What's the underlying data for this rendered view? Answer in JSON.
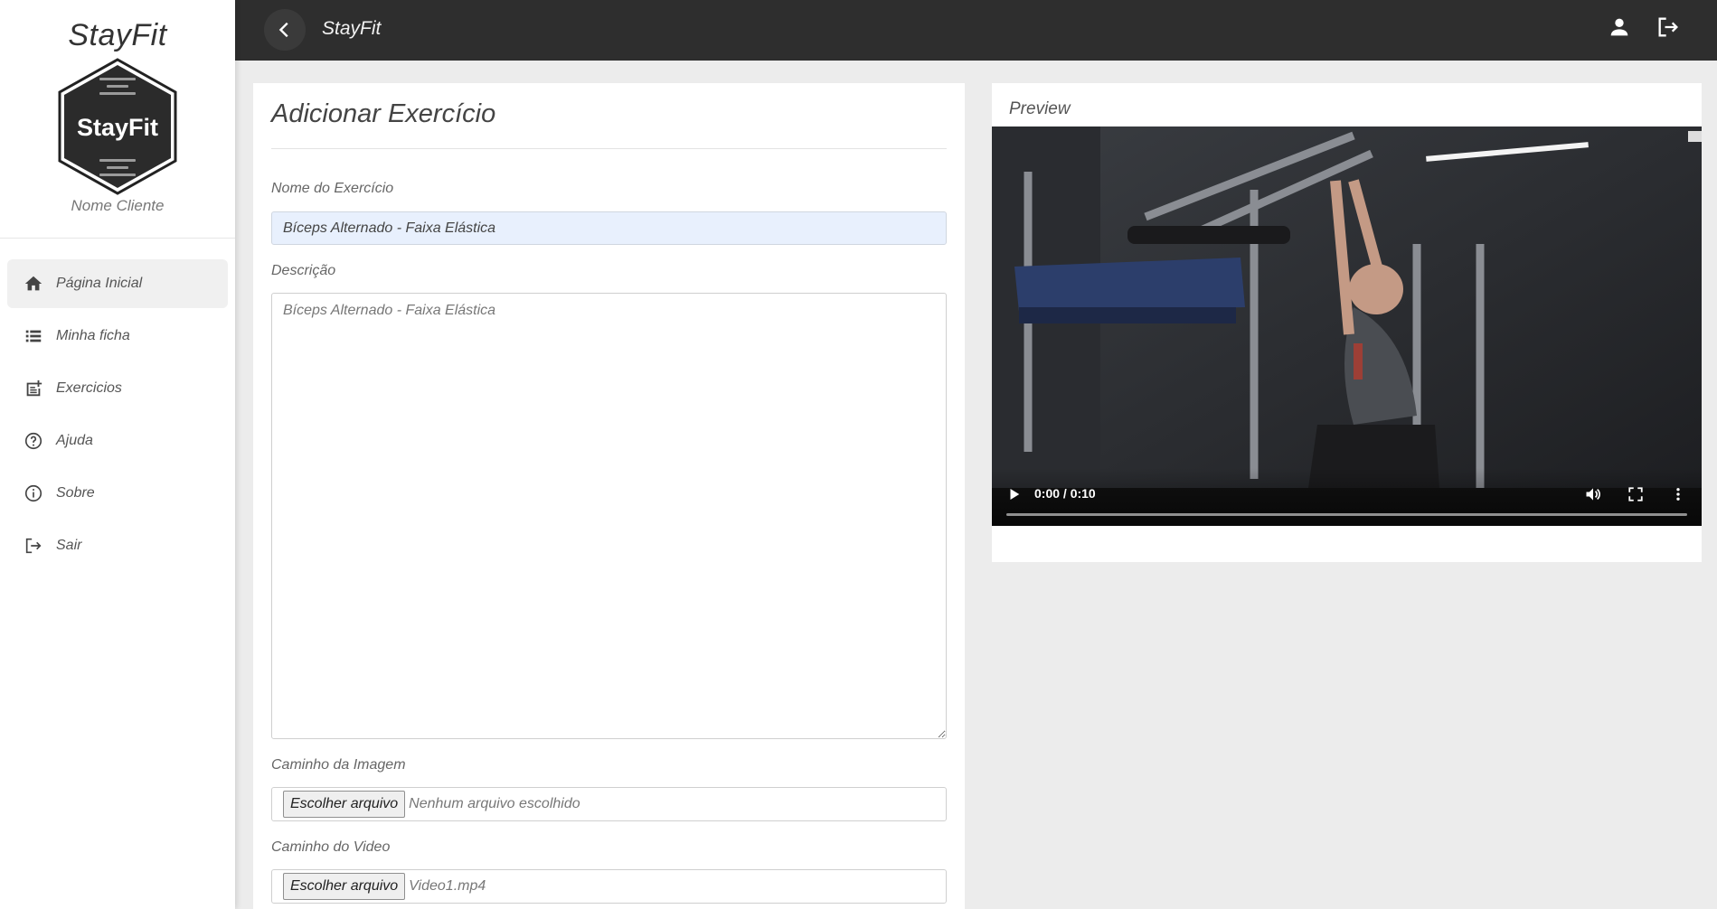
{
  "sidebar": {
    "brand": "StayFit",
    "logo_text": "StayFit",
    "client_name": "Nome Cliente",
    "items": [
      {
        "label": "Página Inicial",
        "icon": "home-icon",
        "active": true
      },
      {
        "label": "Minha ficha",
        "icon": "list-icon",
        "active": false
      },
      {
        "label": "Exercicios",
        "icon": "note-add-icon",
        "active": false
      },
      {
        "label": "Ajuda",
        "icon": "help-circle-icon",
        "active": false
      },
      {
        "label": "Sobre",
        "icon": "info-circle-icon",
        "active": false
      },
      {
        "label": "Sair",
        "icon": "logout-icon",
        "active": false
      }
    ]
  },
  "topbar": {
    "title": "StayFit",
    "icons": [
      "back-arrow-icon",
      "user-icon",
      "logout-icon"
    ]
  },
  "form": {
    "title": "Adicionar Exercício",
    "name_label": "Nome do Exercício",
    "name_value": "Bíceps Alternado - Faixa Elástica",
    "description_label": "Descrição",
    "description_placeholder": "Bíceps Alternado - Faixa Elástica",
    "image_label": "Caminho da Imagem",
    "image_button": "Escolher arquivo",
    "image_file": "Nenhum arquivo escolhido",
    "video_label": "Caminho do Video",
    "video_button": "Escolher arquivo",
    "video_file": "Video1.mp4"
  },
  "preview": {
    "title": "Preview",
    "time": "0:00 / 0:10",
    "progress": 0
  },
  "colors": {
    "topbar": "#2e2e2e",
    "background": "#ececec",
    "input_autofill": "#e8f0fd"
  }
}
